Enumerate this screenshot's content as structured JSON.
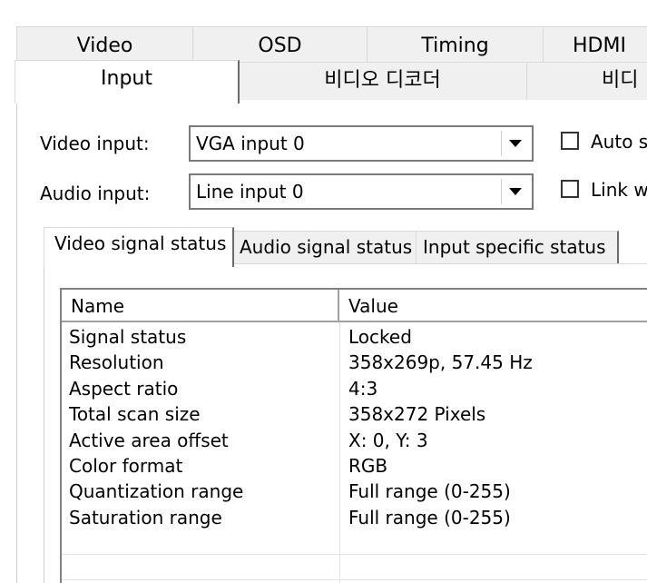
{
  "top_tabs_row1": [
    "Video",
    "OSD",
    "Timing",
    "HDMI"
  ],
  "top_tabs_row2": [
    "Input",
    "비디오 디코더",
    "비디"
  ],
  "inputs": {
    "video_label": "Video input:",
    "video_value": "VGA input 0",
    "audio_label": "Audio input:",
    "audio_value": "Line input 0",
    "auto_check_label": "Auto s",
    "link_check_label": "Link wi"
  },
  "inner_tabs": [
    "Video signal status",
    "Audio signal status",
    "Input specific status"
  ],
  "table": {
    "columns": [
      "Name",
      "Value"
    ],
    "rows": [
      [
        "Signal status",
        "Locked"
      ],
      [
        "Resolution",
        "358x269p, 57.45 Hz"
      ],
      [
        "Aspect ratio",
        "4:3"
      ],
      [
        "Total scan size",
        "358x272 Pixels"
      ],
      [
        "Active area offset",
        "X: 0, Y: 3"
      ],
      [
        "Color format",
        "RGB"
      ],
      [
        "Quantization range",
        "Full range (0-255)"
      ],
      [
        "Saturation range",
        "Full range (0-255)"
      ]
    ]
  },
  "colors": {
    "window_bg": "#ffffff",
    "tab_bg": "#f0f0f0",
    "border_dark": "#6b6b6b",
    "border_light": "#d9d9d9"
  }
}
